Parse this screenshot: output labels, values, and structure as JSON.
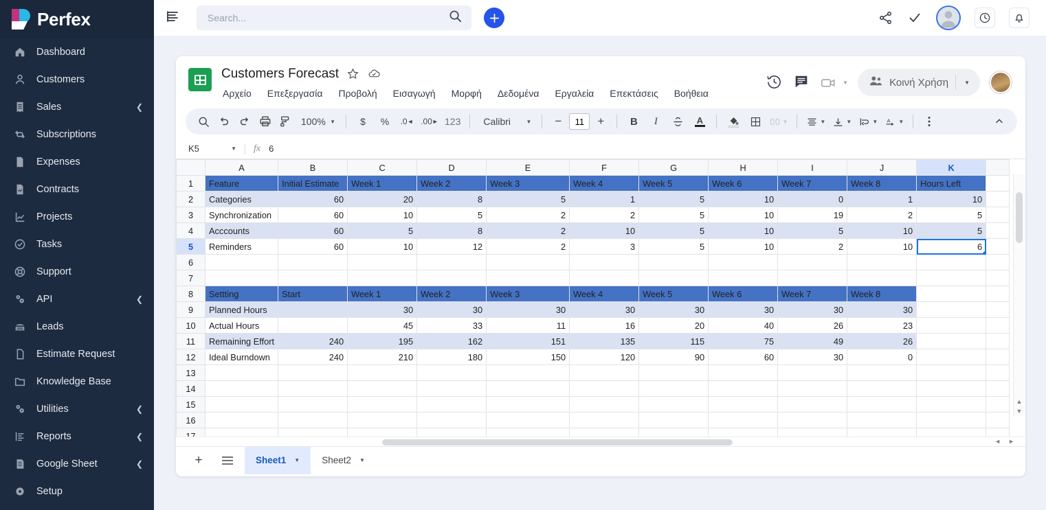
{
  "brand": {
    "name": "Perfex"
  },
  "sidebar": {
    "items": [
      {
        "label": "Dashboard",
        "icon": "home-icon",
        "expandable": false
      },
      {
        "label": "Customers",
        "icon": "user-icon",
        "expandable": false
      },
      {
        "label": "Sales",
        "icon": "receipt-icon",
        "expandable": true
      },
      {
        "label": "Subscriptions",
        "icon": "refresh-icon",
        "expandable": false
      },
      {
        "label": "Expenses",
        "icon": "document-icon",
        "expandable": false
      },
      {
        "label": "Contracts",
        "icon": "contract-icon",
        "expandable": false
      },
      {
        "label": "Projects",
        "icon": "chart-icon",
        "expandable": false
      },
      {
        "label": "Tasks",
        "icon": "check-circle-icon",
        "expandable": false
      },
      {
        "label": "Support",
        "icon": "lifebuoy-icon",
        "expandable": false
      },
      {
        "label": "API",
        "icon": "gears-icon",
        "expandable": true
      },
      {
        "label": "Leads",
        "icon": "phone-icon",
        "expandable": false
      },
      {
        "label": "Estimate Request",
        "icon": "file-icon",
        "expandable": false
      },
      {
        "label": "Knowledge Base",
        "icon": "folder-icon",
        "expandable": false
      },
      {
        "label": "Utilities",
        "icon": "gears-icon",
        "expandable": true
      },
      {
        "label": "Reports",
        "icon": "report-icon",
        "expandable": true
      },
      {
        "label": "Google Sheet",
        "icon": "sheet-icon",
        "expandable": true
      },
      {
        "label": "Setup",
        "icon": "gear-icon",
        "expandable": false
      }
    ]
  },
  "topbar": {
    "search_placeholder": "Search...",
    "search_value": "",
    "add_label": "+",
    "icons": [
      "menu-icon",
      "search-icon",
      "share-icon",
      "check-icon",
      "avatar",
      "history-icon",
      "bell-icon"
    ]
  },
  "doc": {
    "title": "Customers Forecast",
    "star_icon": "star-icon",
    "cloud_icon": "cloud-saved-icon",
    "menus": [
      "Αρχείο",
      "Επεξεργασία",
      "Προβολή",
      "Εισαγωγή",
      "Μορφή",
      "Δεδομένα",
      "Εργαλεία",
      "Επεκτάσεις",
      "Βοήθεια"
    ],
    "share_label": "Κοινή Χρήση"
  },
  "toolbar": {
    "zoom": "100%",
    "currency": "$",
    "percent": "%",
    "dec_less": ".0",
    "dec_more": ".00",
    "formats": "123",
    "font": "Calibri",
    "font_size": "11",
    "bold": "B",
    "italic": "I"
  },
  "formula": {
    "namebox": "K5",
    "fx": "fx",
    "value": "6"
  },
  "grid": {
    "columns": [
      "A",
      "B",
      "C",
      "D",
      "E",
      "F",
      "G",
      "H",
      "I",
      "J",
      "K"
    ],
    "selected_column": "K",
    "selected_row": 5,
    "selected_cell": "K5",
    "rows": [
      {
        "n": 1,
        "style": "hdr",
        "cells": [
          "Feature",
          "Initial Estimate",
          "Week 1",
          "Week 2",
          "Week 3",
          "Week 4",
          "Week 5",
          "Week 6",
          "Week 7",
          "Week 8",
          "Hours Left"
        ]
      },
      {
        "n": 2,
        "style": "banded",
        "cells": [
          "Categories",
          "60",
          "20",
          "8",
          "5",
          "1",
          "5",
          "10",
          "0",
          "1",
          "10"
        ]
      },
      {
        "n": 3,
        "style": "plain",
        "cells": [
          "Synchronization",
          "60",
          "10",
          "5",
          "2",
          "2",
          "5",
          "10",
          "19",
          "2",
          "5"
        ]
      },
      {
        "n": 4,
        "style": "banded",
        "cells": [
          "Acccounts",
          "60",
          "5",
          "8",
          "2",
          "10",
          "5",
          "10",
          "5",
          "10",
          "5"
        ]
      },
      {
        "n": 5,
        "style": "plain",
        "cells": [
          "Reminders",
          "60",
          "10",
          "12",
          "2",
          "3",
          "5",
          "10",
          "2",
          "10",
          "6"
        ]
      },
      {
        "n": 6,
        "style": "empty",
        "cells": [
          "",
          "",
          "",
          "",
          "",
          "",
          "",
          "",
          "",
          "",
          ""
        ]
      },
      {
        "n": 7,
        "style": "empty",
        "cells": [
          "",
          "",
          "",
          "",
          "",
          "",
          "",
          "",
          "",
          "",
          ""
        ]
      },
      {
        "n": 8,
        "style": "hdr",
        "cells": [
          "Settting",
          "Start",
          "Week 1",
          "Week 2",
          "Week 3",
          "Week 4",
          "Week 5",
          "Week 6",
          "Week 7",
          "Week 8",
          ""
        ]
      },
      {
        "n": 9,
        "style": "banded",
        "cells": [
          "Planned Hours",
          "",
          "30",
          "30",
          "30",
          "30",
          "30",
          "30",
          "30",
          "30",
          ""
        ]
      },
      {
        "n": 10,
        "style": "plain",
        "cells": [
          "Actual Hours",
          "",
          "45",
          "33",
          "11",
          "16",
          "20",
          "40",
          "26",
          "23",
          ""
        ]
      },
      {
        "n": 11,
        "style": "banded",
        "cells": [
          "Remaining Effort",
          "240",
          "195",
          "162",
          "151",
          "135",
          "115",
          "75",
          "49",
          "26",
          ""
        ]
      },
      {
        "n": 12,
        "style": "plain",
        "cells": [
          "Ideal Burndown",
          "240",
          "210",
          "180",
          "150",
          "120",
          "90",
          "60",
          "30",
          "0",
          ""
        ]
      },
      {
        "n": 13,
        "style": "empty",
        "cells": [
          "",
          "",
          "",
          "",
          "",
          "",
          "",
          "",
          "",
          "",
          ""
        ]
      },
      {
        "n": 14,
        "style": "empty",
        "cells": [
          "",
          "",
          "",
          "",
          "",
          "",
          "",
          "",
          "",
          "",
          ""
        ]
      },
      {
        "n": 15,
        "style": "empty",
        "cells": [
          "",
          "",
          "",
          "",
          "",
          "",
          "",
          "",
          "",
          "",
          ""
        ]
      },
      {
        "n": 16,
        "style": "empty",
        "cells": [
          "",
          "",
          "",
          "",
          "",
          "",
          "",
          "",
          "",
          "",
          ""
        ]
      },
      {
        "n": 17,
        "style": "empty",
        "cells": [
          "",
          "",
          "",
          "",
          "",
          "",
          "",
          "",
          "",
          "",
          ""
        ]
      }
    ]
  },
  "sheet_tabs": {
    "add_label": "+",
    "list_icon": "all-sheets-icon",
    "tabs": [
      {
        "label": "Sheet1",
        "active": true
      },
      {
        "label": "Sheet2",
        "active": false
      }
    ]
  },
  "colors": {
    "brand_dark": "#1d2b40",
    "accent_blue": "#2653e8",
    "table_header": "#4472c4",
    "table_band": "#d9e1f2",
    "selection": "#1a73e8"
  }
}
